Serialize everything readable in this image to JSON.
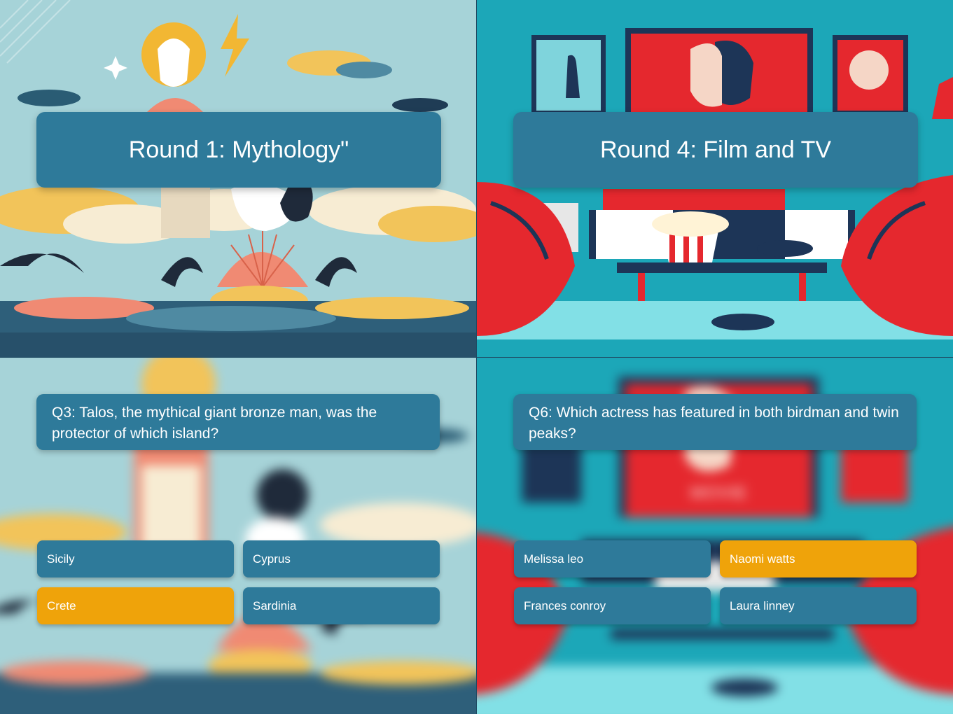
{
  "slides": {
    "mythology_title": {
      "text": "Round 1: Mythology\""
    },
    "film_title": {
      "text": "Round 4: Film and TV"
    },
    "mythology_question": {
      "question": "Q3: Talos, the mythical giant bronze man, was the protector of which island?",
      "answers": [
        "Sicily",
        "Cyprus",
        "Crete",
        "Sardinia"
      ],
      "highlighted_answer": "Crete"
    },
    "film_question": {
      "question": "Q6: Which actress has featured in both birdman and twin peaks?",
      "answers": [
        "Melissa leo",
        "Naomi watts",
        "Frances conroy",
        "Laura linney"
      ],
      "highlighted_answer": "Naomi watts"
    }
  },
  "colors": {
    "card": "#2e7a9a",
    "highlight": "#efa30a",
    "mythology_sky": "#a6d3d8",
    "film_wall": "#1ca7b8",
    "film_red": "#e5282e",
    "film_navy": "#1d3557"
  },
  "art_labels": {
    "poster_text": "MOVIE"
  },
  "icons": [
    "zeus-figure",
    "lightning-bolt",
    "seashell",
    "popcorn-bucket",
    "game-controller",
    "tv-screen",
    "movie-poster"
  ]
}
